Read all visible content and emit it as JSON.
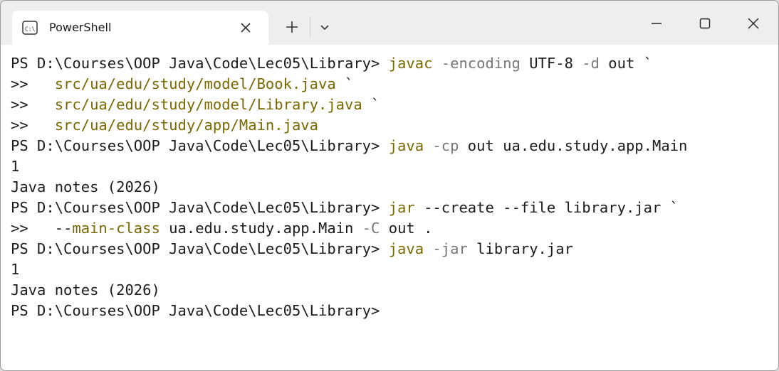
{
  "window": {
    "tab_title": "PowerShell",
    "tab_icon": "terminal-icon"
  },
  "controls": {
    "close_tab_icon": "close-icon",
    "new_tab_icon": "plus-icon",
    "dropdown_icon": "chevron-down-icon",
    "minimize_icon": "minimize-icon",
    "maximize_icon": "maximize-icon",
    "close_window_icon": "close-icon"
  },
  "colors": {
    "command": "#7a6800",
    "parameter": "#777777",
    "text": "#1c1c1c",
    "background": "#ffffff",
    "titlebar": "#eeeeee"
  },
  "console": {
    "lines": [
      {
        "segments": [
          {
            "t": "PS D:\\Courses\\OOP Java\\Code\\Lec05\\Library> ",
            "c": "plain"
          },
          {
            "t": "javac",
            "c": "cmd"
          },
          {
            "t": " -encoding",
            "c": "param"
          },
          {
            "t": " UTF-8",
            "c": "plain"
          },
          {
            "t": " -d",
            "c": "param"
          },
          {
            "t": " out `",
            "c": "plain"
          }
        ]
      },
      {
        "segments": [
          {
            "t": ">>   ",
            "c": "plain"
          },
          {
            "t": "src/ua/edu/study/model/Book.java",
            "c": "argc"
          },
          {
            "t": " `",
            "c": "plain"
          }
        ]
      },
      {
        "segments": [
          {
            "t": ">>   ",
            "c": "plain"
          },
          {
            "t": "src/ua/edu/study/model/Library.java",
            "c": "argc"
          },
          {
            "t": " `",
            "c": "plain"
          }
        ]
      },
      {
        "segments": [
          {
            "t": ">>   ",
            "c": "plain"
          },
          {
            "t": "src/ua/edu/study/app/Main.java",
            "c": "argc"
          }
        ]
      },
      {
        "segments": [
          {
            "t": "PS D:\\Courses\\OOP Java\\Code\\Lec05\\Library> ",
            "c": "plain"
          },
          {
            "t": "java",
            "c": "cmd"
          },
          {
            "t": " -cp",
            "c": "param"
          },
          {
            "t": " out ua.edu.study.app.Main",
            "c": "plain"
          }
        ]
      },
      {
        "segments": [
          {
            "t": "1",
            "c": "plain"
          }
        ]
      },
      {
        "segments": [
          {
            "t": "Java notes (2026)",
            "c": "plain"
          }
        ]
      },
      {
        "segments": [
          {
            "t": "PS D:\\Courses\\OOP Java\\Code\\Lec05\\Library> ",
            "c": "plain"
          },
          {
            "t": "jar",
            "c": "cmd"
          },
          {
            "t": " --create --file library.jar `",
            "c": "plain"
          }
        ]
      },
      {
        "segments": [
          {
            "t": ">>   --",
            "c": "plain"
          },
          {
            "t": "main-class",
            "c": "argc"
          },
          {
            "t": " ua.edu.study.app.Main",
            "c": "plain"
          },
          {
            "t": " -C",
            "c": "param"
          },
          {
            "t": " out .",
            "c": "plain"
          }
        ]
      },
      {
        "segments": [
          {
            "t": "PS D:\\Courses\\OOP Java\\Code\\Lec05\\Library> ",
            "c": "plain"
          },
          {
            "t": "java",
            "c": "cmd"
          },
          {
            "t": " -jar",
            "c": "param"
          },
          {
            "t": " library.jar",
            "c": "plain"
          }
        ]
      },
      {
        "segments": [
          {
            "t": "1",
            "c": "plain"
          }
        ]
      },
      {
        "segments": [
          {
            "t": "Java notes (2026)",
            "c": "plain"
          }
        ]
      },
      {
        "segments": [
          {
            "t": "PS D:\\Courses\\OOP Java\\Code\\Lec05\\Library>",
            "c": "plain"
          }
        ]
      }
    ]
  }
}
